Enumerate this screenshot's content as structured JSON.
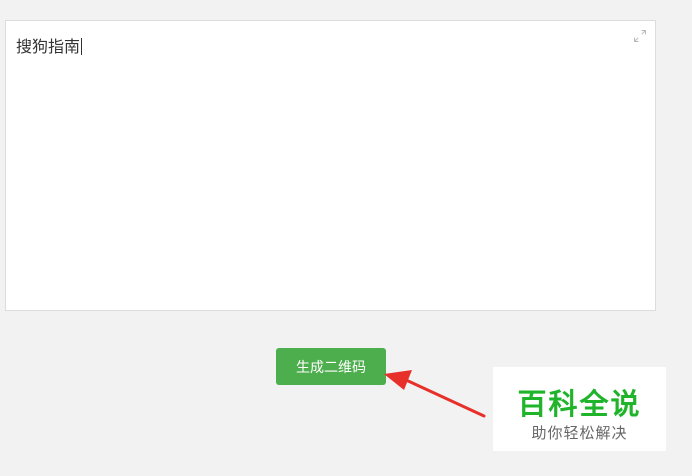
{
  "editor": {
    "text": "搜狗指南",
    "expand_icon": "expand-icon"
  },
  "actions": {
    "generate_label": "生成二维码",
    "button_color": "#4cae4c"
  },
  "annotation": {
    "arrow_color": "#e8302a",
    "arrow_icon": "red-arrow"
  },
  "watermark": {
    "title": "百科全说",
    "subtitle": "助你轻松解决",
    "title_color": "#1fb42a"
  }
}
